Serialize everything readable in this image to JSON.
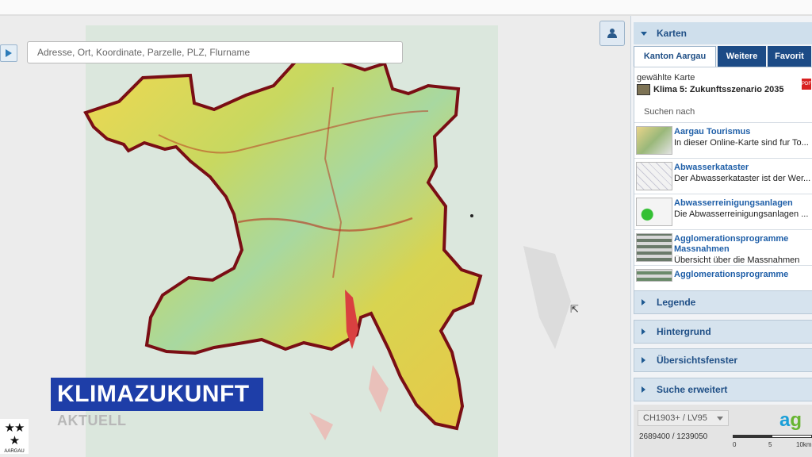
{
  "search": {
    "placeholder": "Adresse, Ort, Koordinate, Parzelle, PLZ, Flurname"
  },
  "overlay": {
    "title": "KLIMAZUKUNFT",
    "subtitle": "AKTUELL",
    "logo_text": "AARGAU"
  },
  "panel": {
    "karten_header": "Karten",
    "tabs": [
      {
        "label": "Kanton Aargau",
        "active": true
      },
      {
        "label": "Weitere",
        "active": false
      },
      {
        "label": "Favorit",
        "active": false
      }
    ],
    "selected_label": "gewählte Karte",
    "selected_map": "Klima 5: Zukunftsszenario 2035",
    "search_label": "Suchen nach",
    "items": [
      {
        "title": "Aargau Tourismus",
        "desc": "In dieser Online-Karte sind fur To..."
      },
      {
        "title": "Abwasserkataster",
        "desc": "Der Abwasserkataster ist der Wer..."
      },
      {
        "title": "Abwasserreinigungsanlagen",
        "desc": "Die Abwasserreinigungsanlagen ..."
      },
      {
        "title": "Agglomerationsprogramme Massnahmen",
        "desc": "Übersicht über die Massnahmen"
      },
      {
        "title": "Agglomerationsprogramme",
        "desc": ""
      }
    ],
    "sections": [
      "Legende",
      "Hintergrund",
      "Übersichtsfenster",
      "Suche erweitert"
    ],
    "crs": "CH1903+ / LV95",
    "coordinates": "2689400 / 1239050",
    "scale_labels": [
      "0",
      "5",
      "10km"
    ],
    "logo": {
      "a": "a",
      "g": "g"
    }
  },
  "colors": {
    "accent": "#1c4b86",
    "title_bg": "#1e3ea8",
    "border_red": "#7a0e14"
  }
}
